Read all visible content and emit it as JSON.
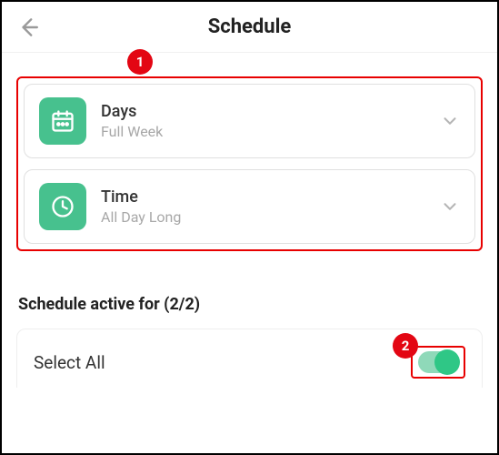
{
  "header": {
    "title": "Schedule"
  },
  "annotations": {
    "badge1": "1",
    "badge2": "2"
  },
  "cards": {
    "days": {
      "title": "Days",
      "subtitle": "Full Week"
    },
    "time": {
      "title": "Time",
      "subtitle": "All Day Long"
    }
  },
  "section": {
    "title": "Schedule active for (2/2)",
    "selectAll": "Select All",
    "toggleOn": true
  }
}
